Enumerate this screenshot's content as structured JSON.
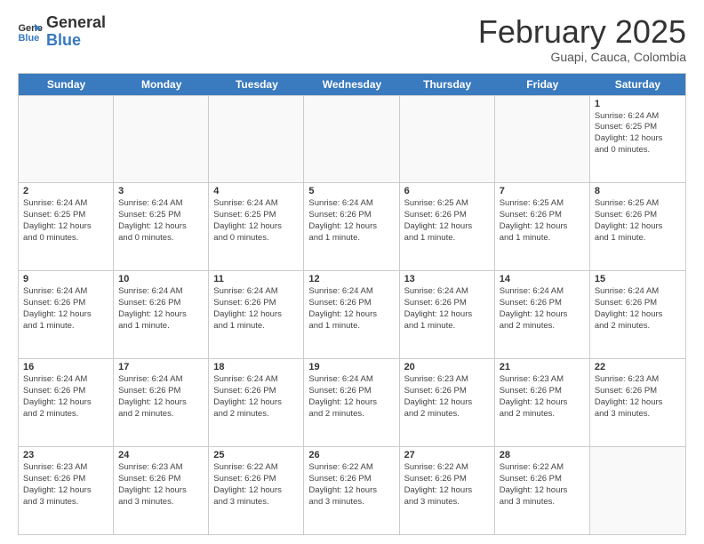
{
  "logo": {
    "line1": "General",
    "line2": "Blue"
  },
  "header": {
    "month": "February 2025",
    "location": "Guapi, Cauca, Colombia"
  },
  "weekdays": [
    "Sunday",
    "Monday",
    "Tuesday",
    "Wednesday",
    "Thursday",
    "Friday",
    "Saturday"
  ],
  "rows": [
    [
      {
        "day": "",
        "info": ""
      },
      {
        "day": "",
        "info": ""
      },
      {
        "day": "",
        "info": ""
      },
      {
        "day": "",
        "info": ""
      },
      {
        "day": "",
        "info": ""
      },
      {
        "day": "",
        "info": ""
      },
      {
        "day": "1",
        "info": "Sunrise: 6:24 AM\nSunset: 6:25 PM\nDaylight: 12 hours\nand 0 minutes."
      }
    ],
    [
      {
        "day": "2",
        "info": "Sunrise: 6:24 AM\nSunset: 6:25 PM\nDaylight: 12 hours\nand 0 minutes."
      },
      {
        "day": "3",
        "info": "Sunrise: 6:24 AM\nSunset: 6:25 PM\nDaylight: 12 hours\nand 0 minutes."
      },
      {
        "day": "4",
        "info": "Sunrise: 6:24 AM\nSunset: 6:25 PM\nDaylight: 12 hours\nand 0 minutes."
      },
      {
        "day": "5",
        "info": "Sunrise: 6:24 AM\nSunset: 6:26 PM\nDaylight: 12 hours\nand 1 minute."
      },
      {
        "day": "6",
        "info": "Sunrise: 6:25 AM\nSunset: 6:26 PM\nDaylight: 12 hours\nand 1 minute."
      },
      {
        "day": "7",
        "info": "Sunrise: 6:25 AM\nSunset: 6:26 PM\nDaylight: 12 hours\nand 1 minute."
      },
      {
        "day": "8",
        "info": "Sunrise: 6:25 AM\nSunset: 6:26 PM\nDaylight: 12 hours\nand 1 minute."
      }
    ],
    [
      {
        "day": "9",
        "info": "Sunrise: 6:24 AM\nSunset: 6:26 PM\nDaylight: 12 hours\nand 1 minute."
      },
      {
        "day": "10",
        "info": "Sunrise: 6:24 AM\nSunset: 6:26 PM\nDaylight: 12 hours\nand 1 minute."
      },
      {
        "day": "11",
        "info": "Sunrise: 6:24 AM\nSunset: 6:26 PM\nDaylight: 12 hours\nand 1 minute."
      },
      {
        "day": "12",
        "info": "Sunrise: 6:24 AM\nSunset: 6:26 PM\nDaylight: 12 hours\nand 1 minute."
      },
      {
        "day": "13",
        "info": "Sunrise: 6:24 AM\nSunset: 6:26 PM\nDaylight: 12 hours\nand 1 minute."
      },
      {
        "day": "14",
        "info": "Sunrise: 6:24 AM\nSunset: 6:26 PM\nDaylight: 12 hours\nand 2 minutes."
      },
      {
        "day": "15",
        "info": "Sunrise: 6:24 AM\nSunset: 6:26 PM\nDaylight: 12 hours\nand 2 minutes."
      }
    ],
    [
      {
        "day": "16",
        "info": "Sunrise: 6:24 AM\nSunset: 6:26 PM\nDaylight: 12 hours\nand 2 minutes."
      },
      {
        "day": "17",
        "info": "Sunrise: 6:24 AM\nSunset: 6:26 PM\nDaylight: 12 hours\nand 2 minutes."
      },
      {
        "day": "18",
        "info": "Sunrise: 6:24 AM\nSunset: 6:26 PM\nDaylight: 12 hours\nand 2 minutes."
      },
      {
        "day": "19",
        "info": "Sunrise: 6:24 AM\nSunset: 6:26 PM\nDaylight: 12 hours\nand 2 minutes."
      },
      {
        "day": "20",
        "info": "Sunrise: 6:23 AM\nSunset: 6:26 PM\nDaylight: 12 hours\nand 2 minutes."
      },
      {
        "day": "21",
        "info": "Sunrise: 6:23 AM\nSunset: 6:26 PM\nDaylight: 12 hours\nand 2 minutes."
      },
      {
        "day": "22",
        "info": "Sunrise: 6:23 AM\nSunset: 6:26 PM\nDaylight: 12 hours\nand 3 minutes."
      }
    ],
    [
      {
        "day": "23",
        "info": "Sunrise: 6:23 AM\nSunset: 6:26 PM\nDaylight: 12 hours\nand 3 minutes."
      },
      {
        "day": "24",
        "info": "Sunrise: 6:23 AM\nSunset: 6:26 PM\nDaylight: 12 hours\nand 3 minutes."
      },
      {
        "day": "25",
        "info": "Sunrise: 6:22 AM\nSunset: 6:26 PM\nDaylight: 12 hours\nand 3 minutes."
      },
      {
        "day": "26",
        "info": "Sunrise: 6:22 AM\nSunset: 6:26 PM\nDaylight: 12 hours\nand 3 minutes."
      },
      {
        "day": "27",
        "info": "Sunrise: 6:22 AM\nSunset: 6:26 PM\nDaylight: 12 hours\nand 3 minutes."
      },
      {
        "day": "28",
        "info": "Sunrise: 6:22 AM\nSunset: 6:26 PM\nDaylight: 12 hours\nand 3 minutes."
      },
      {
        "day": "",
        "info": ""
      }
    ]
  ]
}
